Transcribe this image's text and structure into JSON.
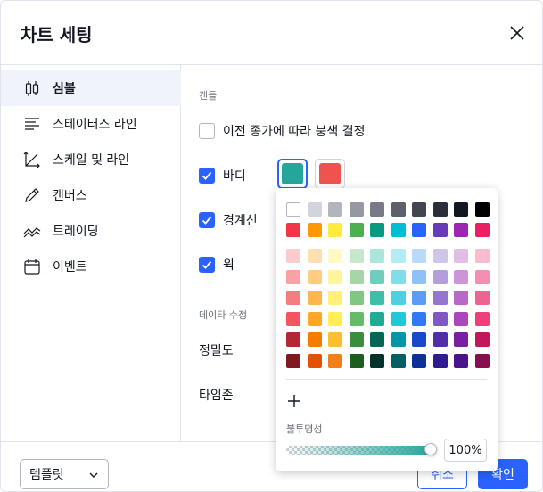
{
  "dialog": {
    "title": "차트 세팅"
  },
  "sidebar": {
    "items": [
      {
        "label": "심볼",
        "icon": "candles-icon",
        "active": true
      },
      {
        "label": "스테이터스 라인",
        "icon": "status-line-icon",
        "active": false
      },
      {
        "label": "스케일 및 라인",
        "icon": "scales-icon",
        "active": false
      },
      {
        "label": "캔버스",
        "icon": "pencil-icon",
        "active": false
      },
      {
        "label": "트레이딩",
        "icon": "trading-icon",
        "active": false
      },
      {
        "label": "이벤트",
        "icon": "calendar-icon",
        "active": false
      }
    ]
  },
  "content": {
    "section_candles": "캔들",
    "prev_close_label": "이전 종가에 따라 붕색 결정",
    "body_label": "바디",
    "border_label": "경계선",
    "wick_label": "윅",
    "section_data": "데이타 수정",
    "precision_label": "정밀도",
    "timezone_label": "타임존",
    "body_up_color": "#26a69a",
    "body_down_color": "#ef5350"
  },
  "color_picker": {
    "top_row": [
      "#ffffff",
      "#d1d4dc",
      "#b2b5be",
      "#9598a1",
      "#787b86",
      "#5d606b",
      "#434651",
      "#2a2e39",
      "#131722",
      "#000000"
    ],
    "main_row": [
      "#f23645",
      "#ff9800",
      "#ffeb3b",
      "#4caf50",
      "#089981",
      "#00bcd4",
      "#2962ff",
      "#673ab7",
      "#9c27b0",
      "#e91e63"
    ],
    "shades": [
      [
        "#fccbcd",
        "#ffe0b2",
        "#fff9c4",
        "#c8e6c9",
        "#ace5dc",
        "#b2ebf2",
        "#bbd9fb",
        "#d1c4e9",
        "#e1bee7",
        "#f8bbd0"
      ],
      [
        "#faa1a4",
        "#ffcc80",
        "#fff59d",
        "#a5d6a7",
        "#70ccbd",
        "#80deea",
        "#90bff9",
        "#b39ddb",
        "#ce93d8",
        "#f48fb1"
      ],
      [
        "#f77c80",
        "#ffb74d",
        "#fff176",
        "#81c784",
        "#42bda8",
        "#4dd0e1",
        "#5b9cf6",
        "#9575cd",
        "#ba68c8",
        "#f06292"
      ],
      [
        "#f7525f",
        "#ffa726",
        "#ffee58",
        "#66bb6a",
        "#22ab94",
        "#26c6da",
        "#3179f5",
        "#7e57c2",
        "#ab47bc",
        "#ec407a"
      ],
      [
        "#b22833",
        "#f57c00",
        "#fbc02d",
        "#388e3c",
        "#056656",
        "#0097a7",
        "#1848cc",
        "#512da8",
        "#7b1fa2",
        "#c2185b"
      ],
      [
        "#801922",
        "#e65100",
        "#f57f17",
        "#1b5e20",
        "#00332a",
        "#006064",
        "#0c3299",
        "#311b92",
        "#4a148c",
        "#880e4f"
      ]
    ],
    "opacity_label": "불투명성",
    "opacity_value": "100%",
    "opacity_fraction": 1.0,
    "slider_color": "#26a69a"
  },
  "footer": {
    "template_label": "템플릿",
    "cancel_label": "취소",
    "ok_label": "확인"
  }
}
